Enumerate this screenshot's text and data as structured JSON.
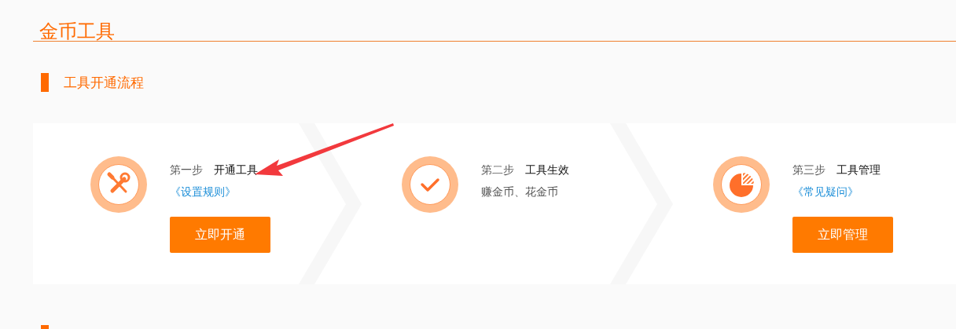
{
  "page_title": "金币工具",
  "section": {
    "title": "工具开通流程"
  },
  "steps": [
    {
      "step": "第一步",
      "name": "开通工具",
      "link": "《设置规则》",
      "button": "立即开通"
    },
    {
      "step": "第二步",
      "name": "工具生效",
      "description": "赚金币、花金币"
    },
    {
      "step": "第三步",
      "name": "工具管理",
      "link": "《常见疑问》",
      "button": "立即管理"
    }
  ]
}
